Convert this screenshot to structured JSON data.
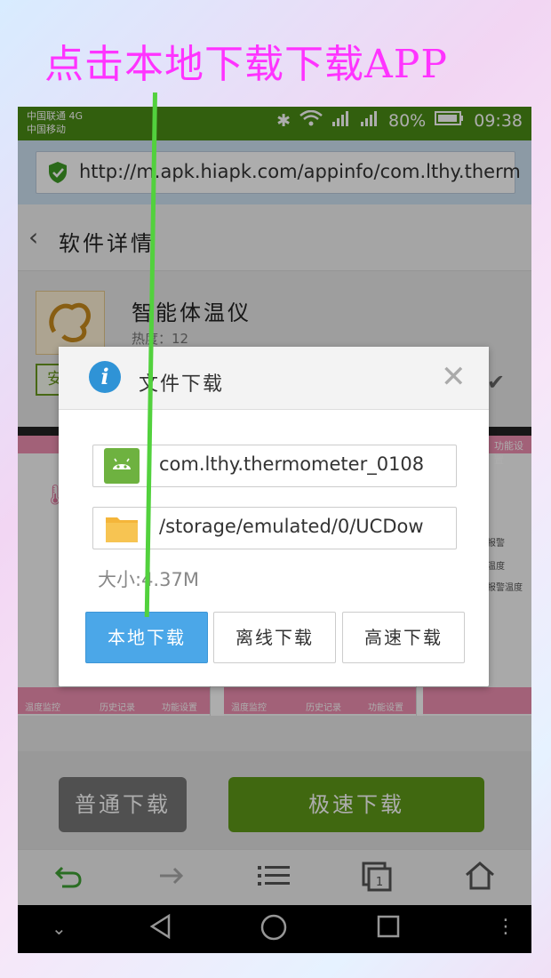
{
  "caption": "点击本地下载下载APP",
  "status_bar": {
    "carrier1": "中国联通 4G",
    "carrier2": "中国移动",
    "battery": "80%",
    "time": "09:38"
  },
  "url_bar": {
    "url": "http://m.apk.hiapk.com/appinfo/com.lthy.therm"
  },
  "header": {
    "title": "软件详情"
  },
  "app": {
    "name": "智能体温仪",
    "heat_label": "热度：12",
    "install_label": "安"
  },
  "dialog": {
    "title": "文件下载",
    "filename": "com.lthy.thermometer_0108",
    "path": "/storage/emulated/0/UCDow",
    "size_label": "大小:4.37M",
    "buttons": {
      "local": "本地下载",
      "offline": "离线下载",
      "fast": "高速下载"
    }
  },
  "download_bar": {
    "normal": "普通下载",
    "fast": "极速下载"
  },
  "screenshots_text": {
    "settings": "功能设置",
    "alarm1": "报警",
    "temp": "温度",
    "alarm2": "报警",
    "alarm_temp": "报警温度",
    "tab1": "温度监控",
    "tab2": "历史记录",
    "tab3": "功能设置"
  },
  "colors": {
    "status_green": "#4a8d16",
    "primary_blue": "#4ba7e8",
    "fast_green": "#5f9a19",
    "caption_magenta": "#ff33ff",
    "guide_line": "#52d13d"
  },
  "icons": [
    "bluetooth-icon",
    "wifi-icon",
    "signal-icon",
    "battery-icon",
    "back-arrow-icon",
    "forward-arrow-icon",
    "menu-icon",
    "tabs-icon",
    "home-icon"
  ]
}
